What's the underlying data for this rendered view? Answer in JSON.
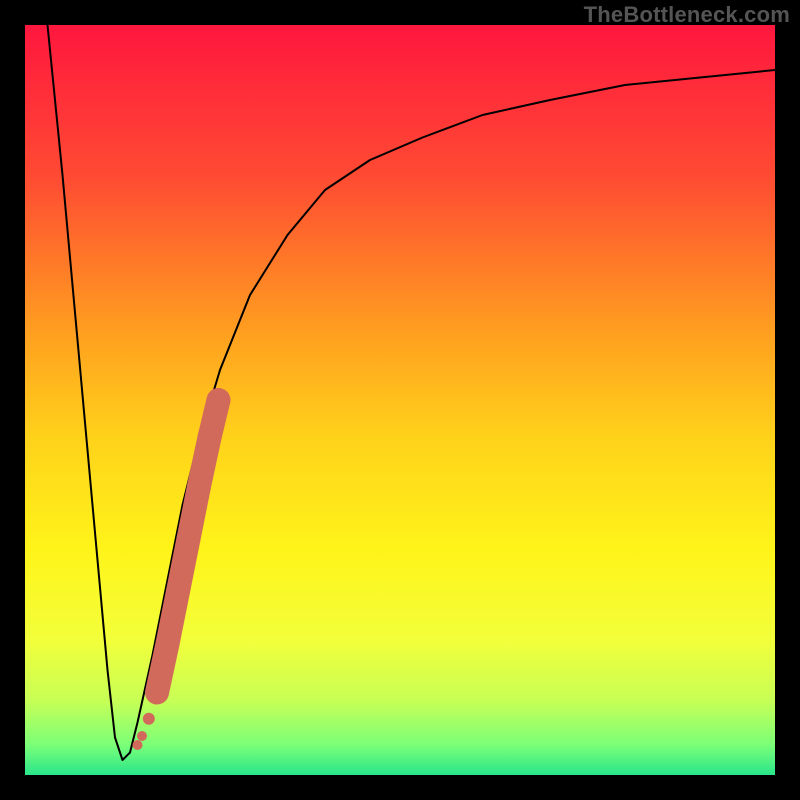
{
  "watermark": "TheBottleneck.com",
  "chart_data": {
    "type": "line",
    "title": "",
    "xlabel": "",
    "ylabel": "",
    "xlim": [
      0,
      100
    ],
    "ylim": [
      0,
      100
    ],
    "grid": false,
    "legend": false,
    "background_gradient_stops": [
      {
        "offset": 0.0,
        "color": "#ff173e"
      },
      {
        "offset": 0.2,
        "color": "#ff4a33"
      },
      {
        "offset": 0.4,
        "color": "#ff9b20"
      },
      {
        "offset": 0.55,
        "color": "#ffd21a"
      },
      {
        "offset": 0.7,
        "color": "#fff41a"
      },
      {
        "offset": 0.82,
        "color": "#f2ff3a"
      },
      {
        "offset": 0.9,
        "color": "#c8ff55"
      },
      {
        "offset": 0.96,
        "color": "#7bff78"
      },
      {
        "offset": 1.0,
        "color": "#29e58a"
      }
    ],
    "series": [
      {
        "name": "bottleneck-curve",
        "color": "#000000",
        "stroke_width": 2,
        "x": [
          3,
          5,
          7,
          9,
          10,
          11,
          12,
          13,
          14,
          15,
          17,
          19,
          21,
          23,
          26,
          30,
          35,
          40,
          46,
          53,
          61,
          70,
          80,
          90,
          100
        ],
        "y": [
          100,
          80,
          58,
          36,
          25,
          14,
          5,
          2,
          3,
          7,
          16,
          26,
          36,
          44,
          54,
          64,
          72,
          78,
          82,
          85,
          88,
          90,
          92,
          93,
          94
        ]
      },
      {
        "name": "highlight-trail",
        "color": "#d26a5c",
        "type": "scatter",
        "x": [
          15.0,
          15.6,
          16.5,
          17.6,
          19.0,
          20.4,
          21.8,
          23.2,
          24.6,
          25.8
        ],
        "y": [
          4.0,
          5.2,
          7.5,
          11.0,
          17.5,
          24.5,
          31.5,
          38.5,
          45.0,
          50.0
        ],
        "r": [
          5,
          5,
          6,
          8,
          12,
          12,
          12,
          12,
          12,
          10
        ]
      }
    ]
  }
}
